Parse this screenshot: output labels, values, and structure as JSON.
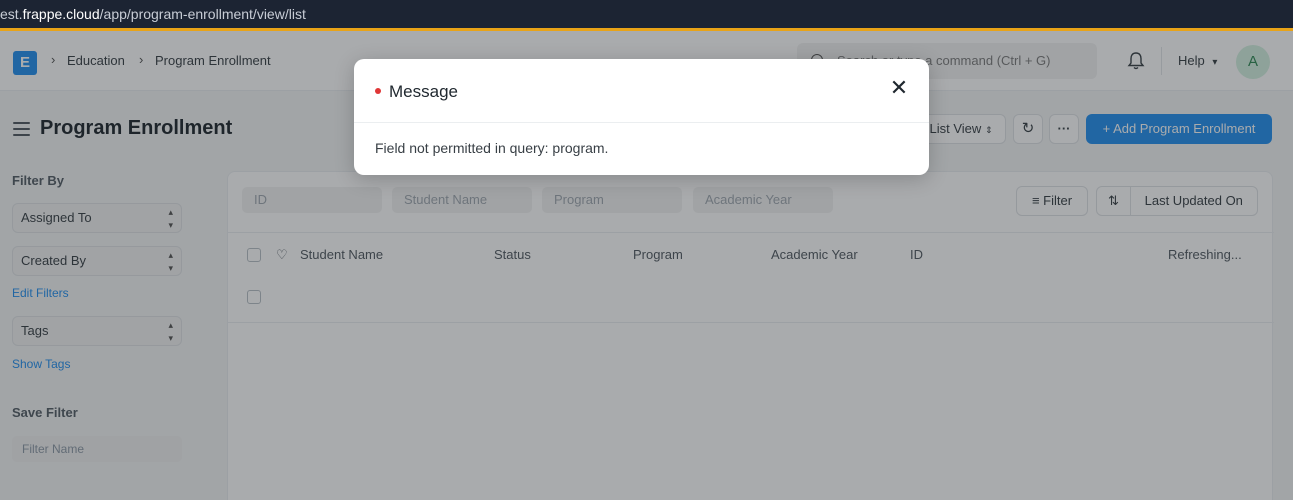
{
  "browser": {
    "url_prefix": "est.",
    "url_host": "frappe.cloud",
    "url_path": "/app/program-enrollment/view/list"
  },
  "navbar": {
    "logo_letter": "E",
    "breadcrumbs": [
      "Education",
      "Program Enrollment"
    ],
    "search_placeholder": "Search or type a command (Ctrl + G)",
    "help_label": "Help",
    "avatar_letter": "A"
  },
  "page": {
    "title": "Program Enrollment",
    "view_label": "List View",
    "add_button": "+ Add Program Enrollment"
  },
  "sidebar": {
    "filter_by_label": "Filter By",
    "assigned_to": "Assigned To",
    "created_by": "Created By",
    "edit_filters": "Edit Filters",
    "tags": "Tags",
    "show_tags": "Show Tags",
    "save_filter_label": "Save Filter",
    "filter_name_placeholder": "Filter Name"
  },
  "list": {
    "filter_fields": [
      "ID",
      "Student Name",
      "Program",
      "Academic Year"
    ],
    "filter_button": "Filter",
    "sort_label": "Last Updated On",
    "columns": [
      "Student Name",
      "Status",
      "Program",
      "Academic Year",
      "ID"
    ],
    "status_text": "Refreshing..."
  },
  "modal": {
    "title": "Message",
    "message": "Field not permitted in query: program.",
    "indicator_color": "#e03636"
  }
}
